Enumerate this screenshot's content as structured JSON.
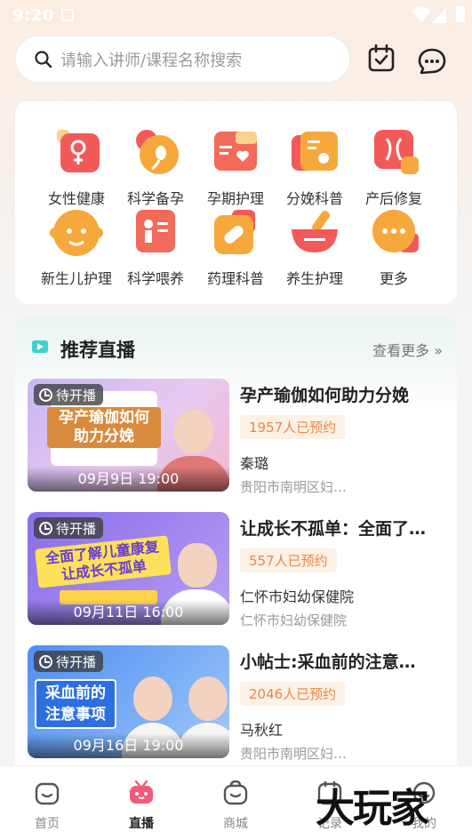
{
  "status_bar": {
    "time": "9:20"
  },
  "search": {
    "placeholder": "请输入讲师/课程名称搜索"
  },
  "categories": [
    {
      "label": "女性健康",
      "icon": "female-icon",
      "color": "#f25a5a"
    },
    {
      "label": "科学备孕",
      "icon": "sperm-icon",
      "color": "#f5a03a"
    },
    {
      "label": "孕期护理",
      "icon": "book-heart-icon",
      "color": "#f26a5a"
    },
    {
      "label": "分娩科普",
      "icon": "baby-card-icon",
      "color": "#f5a03a"
    },
    {
      "label": "产后修复",
      "icon": "body-icon",
      "color": "#f25a5a"
    },
    {
      "label": "新生儿护理",
      "icon": "baby-face-icon",
      "color": "#f5a03a"
    },
    {
      "label": "科学喂养",
      "icon": "feeding-icon",
      "color": "#f26a5a"
    },
    {
      "label": "药理科普",
      "icon": "pill-icon",
      "color": "#f5a03a"
    },
    {
      "label": "养生护理",
      "icon": "mortar-icon",
      "color": "#f25a5a"
    },
    {
      "label": "更多",
      "icon": "more-icon",
      "color": "#f5a03a"
    }
  ],
  "live": {
    "title": "推荐直播",
    "more": "查看更多",
    "items": [
      {
        "status": "待开播",
        "time": "09月9日 19:00",
        "title": "孕产瑜伽如何助力分娩",
        "reservations": "1957人已预约",
        "speaker": "秦璐",
        "org": "贵阳市南明区妇…",
        "poster_text": "孕产瑜伽如何助力分娩"
      },
      {
        "status": "待开播",
        "time": "09月11日 16:00",
        "title": "让成长不孤单：全面了…",
        "reservations": "557人已预约",
        "speaker": "仁怀市妇幼保健院",
        "org": "仁怀市妇幼保健院",
        "poster_text": "全面了解儿童康复 让成长不孤单"
      },
      {
        "status": "待开播",
        "time": "09月16日 19:00",
        "title": "小帖士:采血前的注意…",
        "reservations": "2046人已预约",
        "speaker": "马秋红",
        "org": "贵阳市南明区妇…",
        "poster_text": "采血前的注意事项"
      }
    ]
  },
  "tabs": [
    {
      "label": "首页",
      "active": false
    },
    {
      "label": "直播",
      "active": true
    },
    {
      "label": "商城",
      "active": false
    },
    {
      "label": "记录",
      "active": false
    },
    {
      "label": "我的",
      "active": false
    }
  ],
  "watermark": "大玩家",
  "colors": {
    "accent": "#f25a5a",
    "orange": "#f5a03a",
    "pill_text": "#e48a4a"
  }
}
